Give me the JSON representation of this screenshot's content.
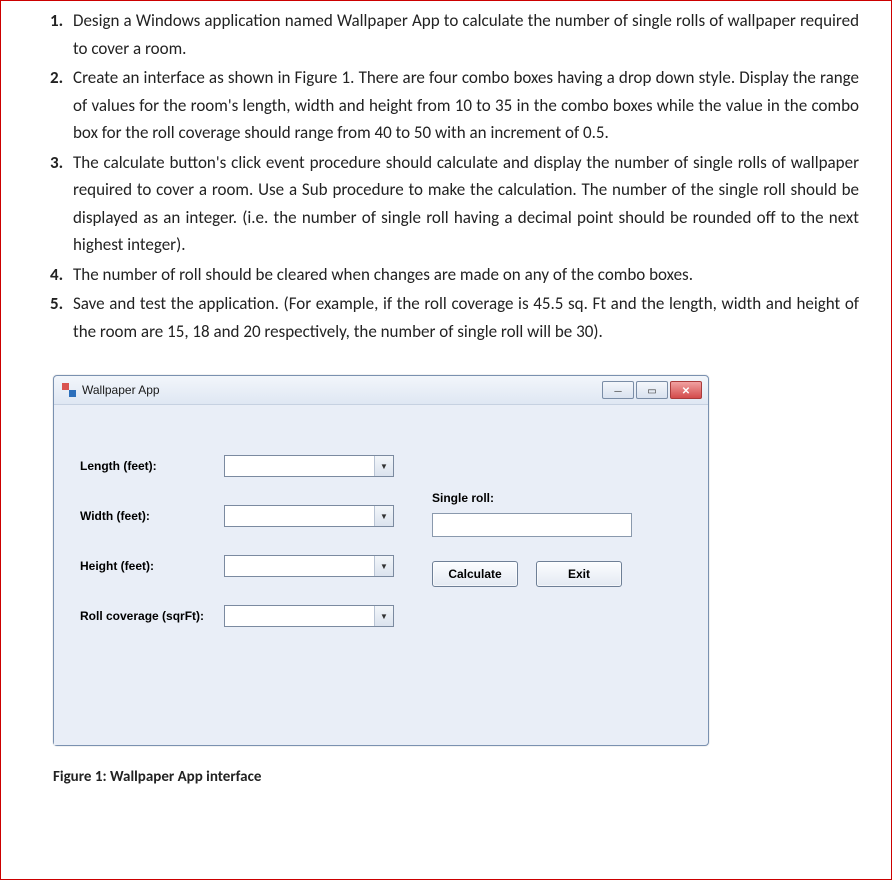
{
  "instructions": {
    "item1": "Design a Windows application named Wallpaper App to calculate the number of single rolls of wallpaper required to cover a room.",
    "item2": "Create an interface as shown in Figure 1. There are four combo boxes having a drop down style. Display the range of values for the room's length, width and height from 10 to 35 in the combo boxes while the value in the combo box for the roll coverage should range from 40 to 50 with an increment of 0.5.",
    "item3": "The calculate button's click event procedure should calculate and display the number of single rolls of wallpaper required to cover a room. Use a Sub procedure to make the calculation. The number of the single roll should be displayed as an integer. (i.e. the number of single roll having a decimal point should be rounded off to the next highest integer).",
    "item4": "The number of roll should be cleared when changes are made on any of the combo boxes.",
    "item5": "Save and test the application. (For example, if the roll coverage is 45.5 sq. Ft and the length, width and height of the room are 15, 18 and 20 respectively, the number of single roll will be 30)."
  },
  "window": {
    "title": "Wallpaper App",
    "labels": {
      "length": "Length (feet):",
      "width": "Width (feet):",
      "height": "Height (feet):",
      "coverage": "Roll coverage (sqrFt):",
      "single_roll": "Single roll:"
    },
    "combos": {
      "length_value": "",
      "width_value": "",
      "height_value": "",
      "coverage_value": ""
    },
    "result_value": "",
    "buttons": {
      "calculate": "Calculate",
      "exit": "Exit"
    }
  },
  "figure": {
    "label": "Figure 1:",
    "caption": "Wallpaper App interface"
  }
}
